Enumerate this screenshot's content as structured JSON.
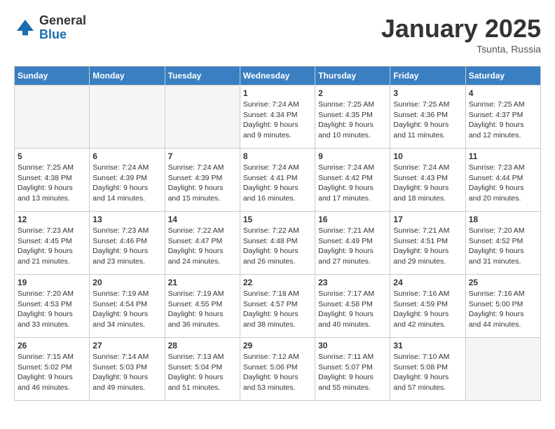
{
  "logo": {
    "general": "General",
    "blue": "Blue"
  },
  "title": "January 2025",
  "subtitle": "Tsunta, Russia",
  "days_of_week": [
    "Sunday",
    "Monday",
    "Tuesday",
    "Wednesday",
    "Thursday",
    "Friday",
    "Saturday"
  ],
  "weeks": [
    [
      {
        "day": "",
        "info": ""
      },
      {
        "day": "",
        "info": ""
      },
      {
        "day": "",
        "info": ""
      },
      {
        "day": "1",
        "info": "Sunrise: 7:24 AM\nSunset: 4:34 PM\nDaylight: 9 hours\nand 9 minutes."
      },
      {
        "day": "2",
        "info": "Sunrise: 7:25 AM\nSunset: 4:35 PM\nDaylight: 9 hours\nand 10 minutes."
      },
      {
        "day": "3",
        "info": "Sunrise: 7:25 AM\nSunset: 4:36 PM\nDaylight: 9 hours\nand 11 minutes."
      },
      {
        "day": "4",
        "info": "Sunrise: 7:25 AM\nSunset: 4:37 PM\nDaylight: 9 hours\nand 12 minutes."
      }
    ],
    [
      {
        "day": "5",
        "info": "Sunrise: 7:25 AM\nSunset: 4:38 PM\nDaylight: 9 hours\nand 13 minutes."
      },
      {
        "day": "6",
        "info": "Sunrise: 7:24 AM\nSunset: 4:39 PM\nDaylight: 9 hours\nand 14 minutes."
      },
      {
        "day": "7",
        "info": "Sunrise: 7:24 AM\nSunset: 4:39 PM\nDaylight: 9 hours\nand 15 minutes."
      },
      {
        "day": "8",
        "info": "Sunrise: 7:24 AM\nSunset: 4:41 PM\nDaylight: 9 hours\nand 16 minutes."
      },
      {
        "day": "9",
        "info": "Sunrise: 7:24 AM\nSunset: 4:42 PM\nDaylight: 9 hours\nand 17 minutes."
      },
      {
        "day": "10",
        "info": "Sunrise: 7:24 AM\nSunset: 4:43 PM\nDaylight: 9 hours\nand 18 minutes."
      },
      {
        "day": "11",
        "info": "Sunrise: 7:23 AM\nSunset: 4:44 PM\nDaylight: 9 hours\nand 20 minutes."
      }
    ],
    [
      {
        "day": "12",
        "info": "Sunrise: 7:23 AM\nSunset: 4:45 PM\nDaylight: 9 hours\nand 21 minutes."
      },
      {
        "day": "13",
        "info": "Sunrise: 7:23 AM\nSunset: 4:46 PM\nDaylight: 9 hours\nand 23 minutes."
      },
      {
        "day": "14",
        "info": "Sunrise: 7:22 AM\nSunset: 4:47 PM\nDaylight: 9 hours\nand 24 minutes."
      },
      {
        "day": "15",
        "info": "Sunrise: 7:22 AM\nSunset: 4:48 PM\nDaylight: 9 hours\nand 26 minutes."
      },
      {
        "day": "16",
        "info": "Sunrise: 7:21 AM\nSunset: 4:49 PM\nDaylight: 9 hours\nand 27 minutes."
      },
      {
        "day": "17",
        "info": "Sunrise: 7:21 AM\nSunset: 4:51 PM\nDaylight: 9 hours\nand 29 minutes."
      },
      {
        "day": "18",
        "info": "Sunrise: 7:20 AM\nSunset: 4:52 PM\nDaylight: 9 hours\nand 31 minutes."
      }
    ],
    [
      {
        "day": "19",
        "info": "Sunrise: 7:20 AM\nSunset: 4:53 PM\nDaylight: 9 hours\nand 33 minutes."
      },
      {
        "day": "20",
        "info": "Sunrise: 7:19 AM\nSunset: 4:54 PM\nDaylight: 9 hours\nand 34 minutes."
      },
      {
        "day": "21",
        "info": "Sunrise: 7:19 AM\nSunset: 4:55 PM\nDaylight: 9 hours\nand 36 minutes."
      },
      {
        "day": "22",
        "info": "Sunrise: 7:18 AM\nSunset: 4:57 PM\nDaylight: 9 hours\nand 38 minutes."
      },
      {
        "day": "23",
        "info": "Sunrise: 7:17 AM\nSunset: 4:58 PM\nDaylight: 9 hours\nand 40 minutes."
      },
      {
        "day": "24",
        "info": "Sunrise: 7:16 AM\nSunset: 4:59 PM\nDaylight: 9 hours\nand 42 minutes."
      },
      {
        "day": "25",
        "info": "Sunrise: 7:16 AM\nSunset: 5:00 PM\nDaylight: 9 hours\nand 44 minutes."
      }
    ],
    [
      {
        "day": "26",
        "info": "Sunrise: 7:15 AM\nSunset: 5:02 PM\nDaylight: 9 hours\nand 46 minutes."
      },
      {
        "day": "27",
        "info": "Sunrise: 7:14 AM\nSunset: 5:03 PM\nDaylight: 9 hours\nand 49 minutes."
      },
      {
        "day": "28",
        "info": "Sunrise: 7:13 AM\nSunset: 5:04 PM\nDaylight: 9 hours\nand 51 minutes."
      },
      {
        "day": "29",
        "info": "Sunrise: 7:12 AM\nSunset: 5:06 PM\nDaylight: 9 hours\nand 53 minutes."
      },
      {
        "day": "30",
        "info": "Sunrise: 7:11 AM\nSunset: 5:07 PM\nDaylight: 9 hours\nand 55 minutes."
      },
      {
        "day": "31",
        "info": "Sunrise: 7:10 AM\nSunset: 5:08 PM\nDaylight: 9 hours\nand 57 minutes."
      },
      {
        "day": "",
        "info": ""
      }
    ]
  ]
}
